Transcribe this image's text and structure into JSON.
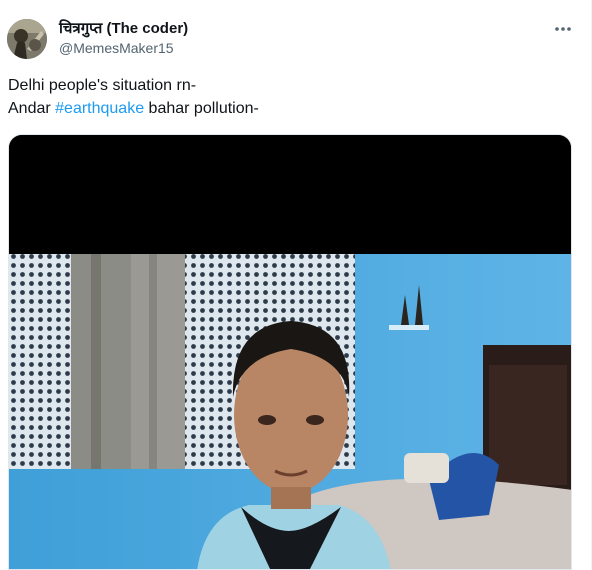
{
  "tweet": {
    "author": {
      "display_name": "चित्रगुप्त (The coder)",
      "handle": "@MemesMaker15"
    },
    "text_line_1": "Delhi people's situation rn-",
    "text_line_2_prefix": "Andar ",
    "hashtag": "#earthquake",
    "text_line_2_suffix": " bahar pollution-",
    "more_icon": "more-horizontal-icon",
    "colors": {
      "text": "#0f1419",
      "secondary": "#536471",
      "link": "#1d9bf0",
      "border": "#eff3f4"
    }
  }
}
